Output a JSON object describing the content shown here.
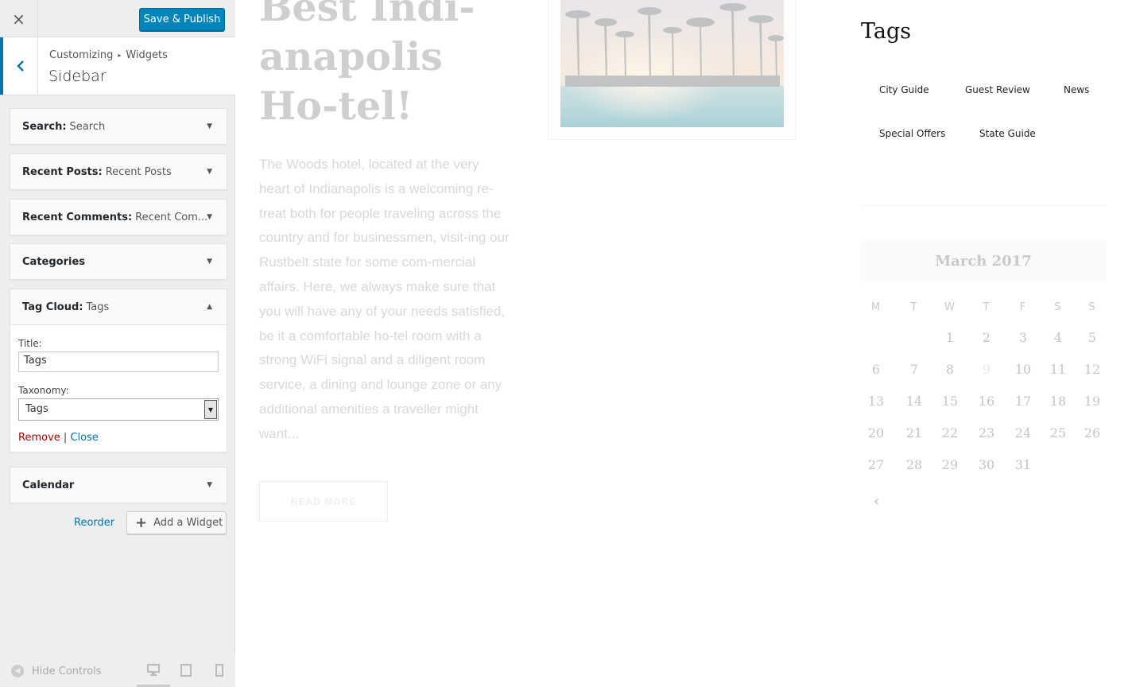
{
  "header": {
    "close_label": "×",
    "save_label": "Save & Publish"
  },
  "section": {
    "crumb_parent": "Customizing",
    "crumb_separator": "▸",
    "crumb_child": "Widgets",
    "name": "Sidebar"
  },
  "widgets": [
    {
      "type": "Search",
      "title": "Search",
      "expanded": false
    },
    {
      "type": "Recent Posts",
      "title": "Recent Posts",
      "expanded": false
    },
    {
      "type": "Recent Comments",
      "title": "Recent Com...",
      "expanded": false
    },
    {
      "type": "Categories",
      "title": "",
      "expanded": false
    },
    {
      "type": "Tag Cloud",
      "title": "Tags",
      "expanded": true
    },
    {
      "type": "Calendar",
      "title": "",
      "expanded": false
    }
  ],
  "tag_cloud_form": {
    "title_label": "Title:",
    "title_value": "Tags",
    "taxonomy_label": "Taxonomy:",
    "taxonomy_value": "Tags",
    "remove_label": "Remove",
    "divider": "|",
    "close_label": "Close"
  },
  "controls": {
    "reorder_label": "Reorder",
    "add_widget_label": "Add a Widget",
    "hide_controls_label": "Hide Controls"
  },
  "preview": {
    "post_title": "Best Indi-anapolis Ho-tel!",
    "post_excerpt": "The Woods hotel, located at the very heart of Indianapolis is a welcoming re-treat both for people traveling across the country and for businessmen, visit-ing our Rustbelt state for some com-mercial affairs. Here, we always make sure that you will have any of your needs satisfied, be it a comfortable ho-tel room with a strong WiFi signal and a diligent room service, a dining and lounge zone or any additional amenities a traveller might want...",
    "read_more_label": "READ MORE",
    "tags_title": "Tags",
    "tags": [
      "City Guide",
      "Guest Review",
      "News",
      "Special Offers",
      "State Guide"
    ],
    "calendar": {
      "month": "March 2017",
      "weekdays": [
        "M",
        "T",
        "W",
        "T",
        "F",
        "S",
        "S"
      ],
      "weeks": [
        [
          "",
          "",
          "1",
          "2",
          "3",
          "4",
          "5"
        ],
        [
          "6",
          "7",
          "8",
          "9",
          "10",
          "11",
          "12"
        ],
        [
          "13",
          "14",
          "15",
          "16",
          "17",
          "18",
          "19"
        ],
        [
          "20",
          "21",
          "22",
          "23",
          "24",
          "25",
          "26"
        ],
        [
          "27",
          "28",
          "29",
          "30",
          "31",
          "",
          ""
        ]
      ],
      "prev_label": "‹"
    }
  },
  "colors": {
    "accent": "#0085ba",
    "link": "#0073aa",
    "remove": "#aa0000",
    "panel_bg": "#eeeeee"
  }
}
